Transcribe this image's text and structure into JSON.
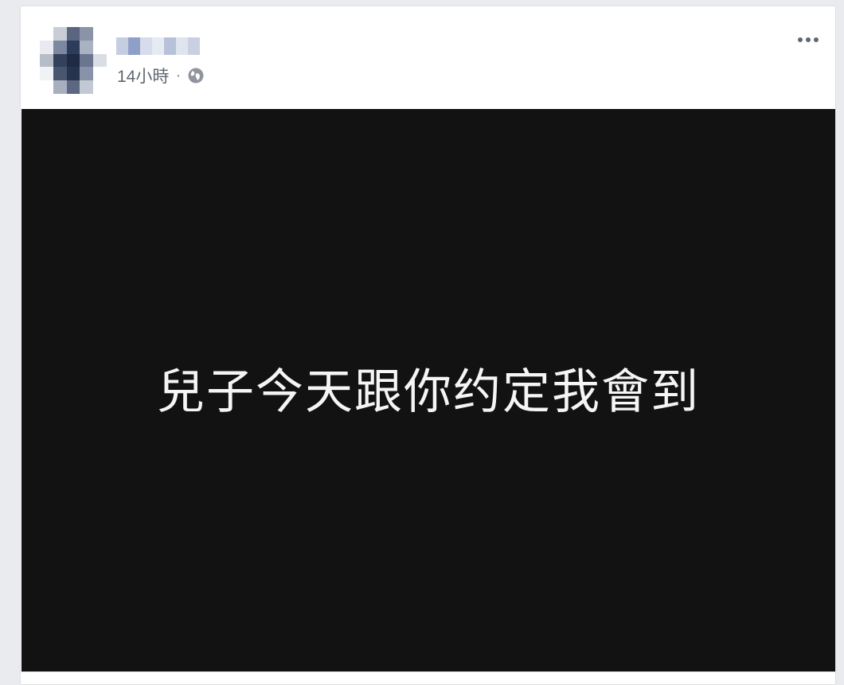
{
  "post": {
    "author_name": "",
    "timestamp": "14小時",
    "separator": "·",
    "privacy_icon": "globe-icon",
    "more_icon": "more-options-icon",
    "image_text": "兒子今天跟你约定我會到"
  },
  "colors": {
    "background": "#e9ebee",
    "card": "#ffffff",
    "image_bg": "#121212",
    "meta_text": "#616770",
    "avatar_pixels": [
      "#ffffff",
      "#c9ced6",
      "#5a6680",
      "#8a93a8",
      "#ffffff",
      "#e8eaef",
      "#7c88a0",
      "#2d3c5a",
      "#aab2c2",
      "#ffffff",
      "#b6bdc9",
      "#33415c",
      "#1f2b44",
      "#6a7690",
      "#d9dde4",
      "#f0f2f5",
      "#4a5670",
      "#27344e",
      "#8892a8",
      "#ffffff",
      "#ffffff",
      "#a8b0c0",
      "#5c6882",
      "#c3c9d4",
      "#ffffff"
    ],
    "name_pixels": [
      "#c5cde0",
      "#8fa0c8",
      "#d6dcea",
      "#e6eaf2",
      "#b7c2da",
      "#dfe4ef",
      "#c8d0e2"
    ]
  }
}
